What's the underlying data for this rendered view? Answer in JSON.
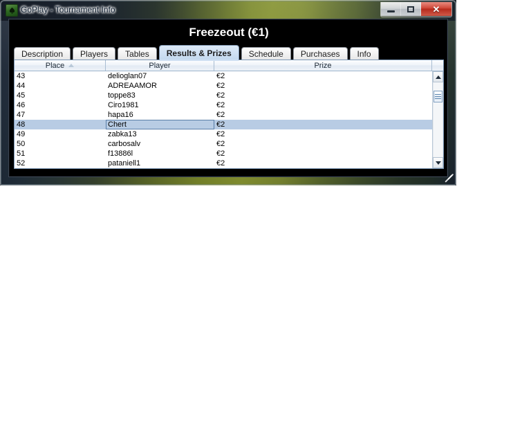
{
  "window": {
    "title": "GoPlay - Tournament Info",
    "icon": "spade-icon",
    "controls": {
      "minimize_label": "–",
      "maximize_label": "□",
      "close_label": "✕"
    }
  },
  "app": {
    "heading": "Freezeout (€1)",
    "tabs": [
      {
        "label": "Description",
        "selected": false
      },
      {
        "label": "Players",
        "selected": false
      },
      {
        "label": "Tables",
        "selected": false
      },
      {
        "label": "Results & Prizes",
        "selected": true
      },
      {
        "label": "Schedule",
        "selected": false
      },
      {
        "label": "Purchases",
        "selected": false
      },
      {
        "label": "Info",
        "selected": false
      }
    ],
    "grid": {
      "columns": [
        {
          "key": "place",
          "label": "Place",
          "sorted": "ascending"
        },
        {
          "key": "player",
          "label": "Player",
          "sorted": "none"
        },
        {
          "key": "prize",
          "label": "Prize",
          "sorted": "none"
        }
      ],
      "rows": [
        {
          "place": "43",
          "player": "delioglan07",
          "prize": "€2",
          "selected": false
        },
        {
          "place": "44",
          "player": "ADREAAMOR",
          "prize": "€2",
          "selected": false
        },
        {
          "place": "45",
          "player": "toppe83",
          "prize": "€2",
          "selected": false
        },
        {
          "place": "46",
          "player": "Ciro1981",
          "prize": "€2",
          "selected": false
        },
        {
          "place": "47",
          "player": "hapa16",
          "prize": "€2",
          "selected": false
        },
        {
          "place": "48",
          "player": "Chert",
          "prize": "€2",
          "selected": true
        },
        {
          "place": "49",
          "player": "zabka13",
          "prize": "€2",
          "selected": false
        },
        {
          "place": "50",
          "player": "carbosalv",
          "prize": "€2",
          "selected": false
        },
        {
          "place": "51",
          "player": "f13886l",
          "prize": "€2",
          "selected": false
        },
        {
          "place": "52",
          "player": "pataniell1",
          "prize": "€2",
          "selected": false
        }
      ],
      "scrollbar": {
        "up_icon": "triangle-up-icon",
        "down_icon": "triangle-down-icon",
        "thumb_position_percent": 13
      }
    }
  },
  "colors": {
    "selection": "#b8cce4",
    "tab_selected": "#cfe0f3",
    "client_background": "#000000",
    "close_button": "#b62a1c"
  }
}
